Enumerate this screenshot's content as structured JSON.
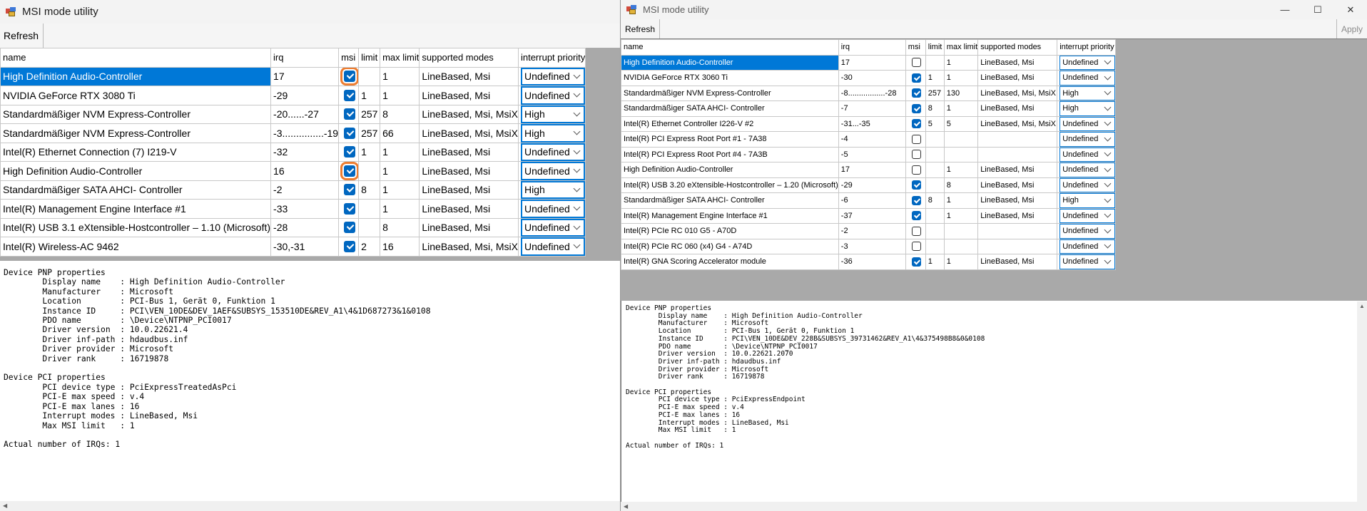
{
  "left": {
    "title": "MSI mode utility",
    "refresh": "Refresh",
    "columns": [
      "name",
      "irq",
      "msi",
      "limit",
      "max limit",
      "supported modes",
      "interrupt priority"
    ],
    "rows": [
      {
        "name": "High Definition Audio-Controller",
        "irq": "17",
        "msi": true,
        "limit": "",
        "maxlimit": "1",
        "modes": "LineBased, Msi",
        "priority": "Undefined"
      },
      {
        "name": "NVIDIA GeForce RTX 3080 Ti",
        "irq": "-29",
        "msi": true,
        "limit": "1",
        "maxlimit": "1",
        "modes": "LineBased, Msi",
        "priority": "Undefined"
      },
      {
        "name": "Standardmäßiger NVM Express-Controller",
        "irq": "-20......-27",
        "msi": true,
        "limit": "257",
        "maxlimit": "8",
        "modes": "LineBased, Msi, MsiX",
        "priority": "High"
      },
      {
        "name": "Standardmäßiger NVM Express-Controller",
        "irq": "-3...............-19",
        "msi": true,
        "limit": "257",
        "maxlimit": "66",
        "modes": "LineBased, Msi, MsiX",
        "priority": "High"
      },
      {
        "name": "Intel(R) Ethernet Connection (7) I219-V",
        "irq": "-32",
        "msi": true,
        "limit": "1",
        "maxlimit": "1",
        "modes": "LineBased, Msi",
        "priority": "Undefined"
      },
      {
        "name": "High Definition Audio-Controller",
        "irq": "16",
        "msi": true,
        "limit": "",
        "maxlimit": "1",
        "modes": "LineBased, Msi",
        "priority": "Undefined"
      },
      {
        "name": "Standardmäßiger SATA AHCI- Controller",
        "irq": "-2",
        "msi": true,
        "limit": "8",
        "maxlimit": "1",
        "modes": "LineBased, Msi",
        "priority": "High"
      },
      {
        "name": "Intel(R) Management Engine Interface #1",
        "irq": "-33",
        "msi": true,
        "limit": "",
        "maxlimit": "1",
        "modes": "LineBased, Msi",
        "priority": "Undefined"
      },
      {
        "name": "Intel(R) USB 3.1 eXtensible-Hostcontroller – 1.10 (Microsoft)",
        "irq": "-28",
        "msi": true,
        "limit": "",
        "maxlimit": "8",
        "modes": "LineBased, Msi",
        "priority": "Undefined"
      },
      {
        "name": "Intel(R) Wireless-AC 9462",
        "irq": "-30,-31",
        "msi": true,
        "limit": "2",
        "maxlimit": "16",
        "modes": "LineBased, Msi, MsiX",
        "priority": "Undefined"
      }
    ],
    "properties": [
      "Device PNP properties",
      "        Display name    : High Definition Audio-Controller",
      "        Manufacturer    : Microsoft",
      "        Location        : PCI-Bus 1, Gerät 0, Funktion 1",
      "        Instance ID     : PCI\\VEN_10DE&DEV_1AEF&SUBSYS_153510DE&REV_A1\\4&1D687273&1&0108",
      "        PDO name        : \\Device\\NTPNP_PCI0017",
      "        Driver version  : 10.0.22621.4",
      "        Driver inf-path : hdaudbus.inf",
      "        Driver provider : Microsoft",
      "        Driver rank     : 16719878",
      "",
      "Device PCI properties",
      "        PCI device type : PciExpressTreatedAsPci",
      "        PCI-E max speed : v.4",
      "        PCI-E max lanes : 16",
      "        Interrupt modes : LineBased, Msi",
      "        Max MSI limit   : 1",
      "",
      "Actual number of IRQs: 1"
    ]
  },
  "right": {
    "title": "MSI mode utility",
    "refresh": "Refresh",
    "apply": "Apply",
    "columns": [
      "name",
      "irq",
      "msi",
      "limit",
      "max limit",
      "supported modes",
      "interrupt priority"
    ],
    "rows": [
      {
        "name": "High Definition Audio-Controller",
        "irq": "17",
        "msi": false,
        "limit": "",
        "maxlimit": "1",
        "modes": "LineBased, Msi",
        "priority": "Undefined"
      },
      {
        "name": "NVIDIA GeForce RTX 3060 Ti",
        "irq": "-30",
        "msi": true,
        "limit": "1",
        "maxlimit": "1",
        "modes": "LineBased, Msi",
        "priority": "Undefined"
      },
      {
        "name": "Standardmäßiger NVM Express-Controller",
        "irq": "-8.................-28",
        "msi": true,
        "limit": "257",
        "maxlimit": "130",
        "modes": "LineBased, Msi, MsiX",
        "priority": "High"
      },
      {
        "name": "Standardmäßiger SATA AHCI- Controller",
        "irq": "-7",
        "msi": true,
        "limit": "8",
        "maxlimit": "1",
        "modes": "LineBased, Msi",
        "priority": "High"
      },
      {
        "name": "Intel(R) Ethernet Controller I226-V #2",
        "irq": "-31...-35",
        "msi": true,
        "limit": "5",
        "maxlimit": "5",
        "modes": "LineBased, Msi, MsiX",
        "priority": "Undefined"
      },
      {
        "name": "Intel(R) PCI Express Root Port #1 - 7A38",
        "irq": "-4",
        "msi": false,
        "limit": "",
        "maxlimit": "",
        "modes": "",
        "priority": "Undefined"
      },
      {
        "name": "Intel(R) PCI Express Root Port #4 - 7A3B",
        "irq": "-5",
        "msi": false,
        "limit": "",
        "maxlimit": "",
        "modes": "",
        "priority": "Undefined"
      },
      {
        "name": "High Definition Audio-Controller",
        "irq": "17",
        "msi": false,
        "limit": "",
        "maxlimit": "1",
        "modes": "LineBased, Msi",
        "priority": "Undefined"
      },
      {
        "name": "Intel(R) USB 3.20 eXtensible-Hostcontroller – 1.20 (Microsoft)",
        "irq": "-29",
        "msi": true,
        "limit": "",
        "maxlimit": "8",
        "modes": "LineBased, Msi",
        "priority": "Undefined"
      },
      {
        "name": "Standardmäßiger SATA AHCI- Controller",
        "irq": "-6",
        "msi": true,
        "limit": "8",
        "maxlimit": "1",
        "modes": "LineBased, Msi",
        "priority": "High"
      },
      {
        "name": "Intel(R) Management Engine Interface #1",
        "irq": "-37",
        "msi": true,
        "limit": "",
        "maxlimit": "1",
        "modes": "LineBased, Msi",
        "priority": "Undefined"
      },
      {
        "name": "Intel(R) PCIe RC 010 G5 - A70D",
        "irq": "-2",
        "msi": false,
        "limit": "",
        "maxlimit": "",
        "modes": "",
        "priority": "Undefined"
      },
      {
        "name": "Intel(R) PCIe RC 060 (x4) G4 - A74D",
        "irq": "-3",
        "msi": false,
        "limit": "",
        "maxlimit": "",
        "modes": "",
        "priority": "Undefined"
      },
      {
        "name": "Intel(R) GNA Scoring Accelerator module",
        "irq": "-36",
        "msi": true,
        "limit": "1",
        "maxlimit": "1",
        "modes": "LineBased, Msi",
        "priority": "Undefined"
      }
    ],
    "properties": [
      "Device PNP properties",
      "        Display name    : High Definition Audio-Controller",
      "        Manufacturer    : Microsoft",
      "        Location        : PCI-Bus 1, Gerät 0, Funktion 1",
      "        Instance ID     : PCI\\VEN_10DE&DEV_228B&SUBSYS_39731462&REV_A1\\4&375498B8&0&0108",
      "        PDO name        : \\Device\\NTPNP_PCI0017",
      "        Driver version  : 10.0.22621.2070",
      "        Driver inf-path : hdaudbus.inf",
      "        Driver provider : Microsoft",
      "        Driver rank     : 16719878",
      "",
      "Device PCI properties",
      "        PCI device type : PciExpressEndpoint",
      "        PCI-E max speed : v.4",
      "        PCI-E max lanes : 16",
      "        Interrupt modes : LineBased, Msi",
      "        Max MSI limit   : 1",
      "",
      "Actual number of IRQs: 1"
    ]
  },
  "icons": {
    "minimize": "minimize-icon",
    "maximize": "maximize-icon",
    "close": "close-icon",
    "app": "msi-utility-app-icon"
  },
  "colors": {
    "selection": "#0078d7",
    "checkbox": "#0067c0",
    "highlight": "#ed7d31",
    "grid_background": "#a9a9a9"
  }
}
